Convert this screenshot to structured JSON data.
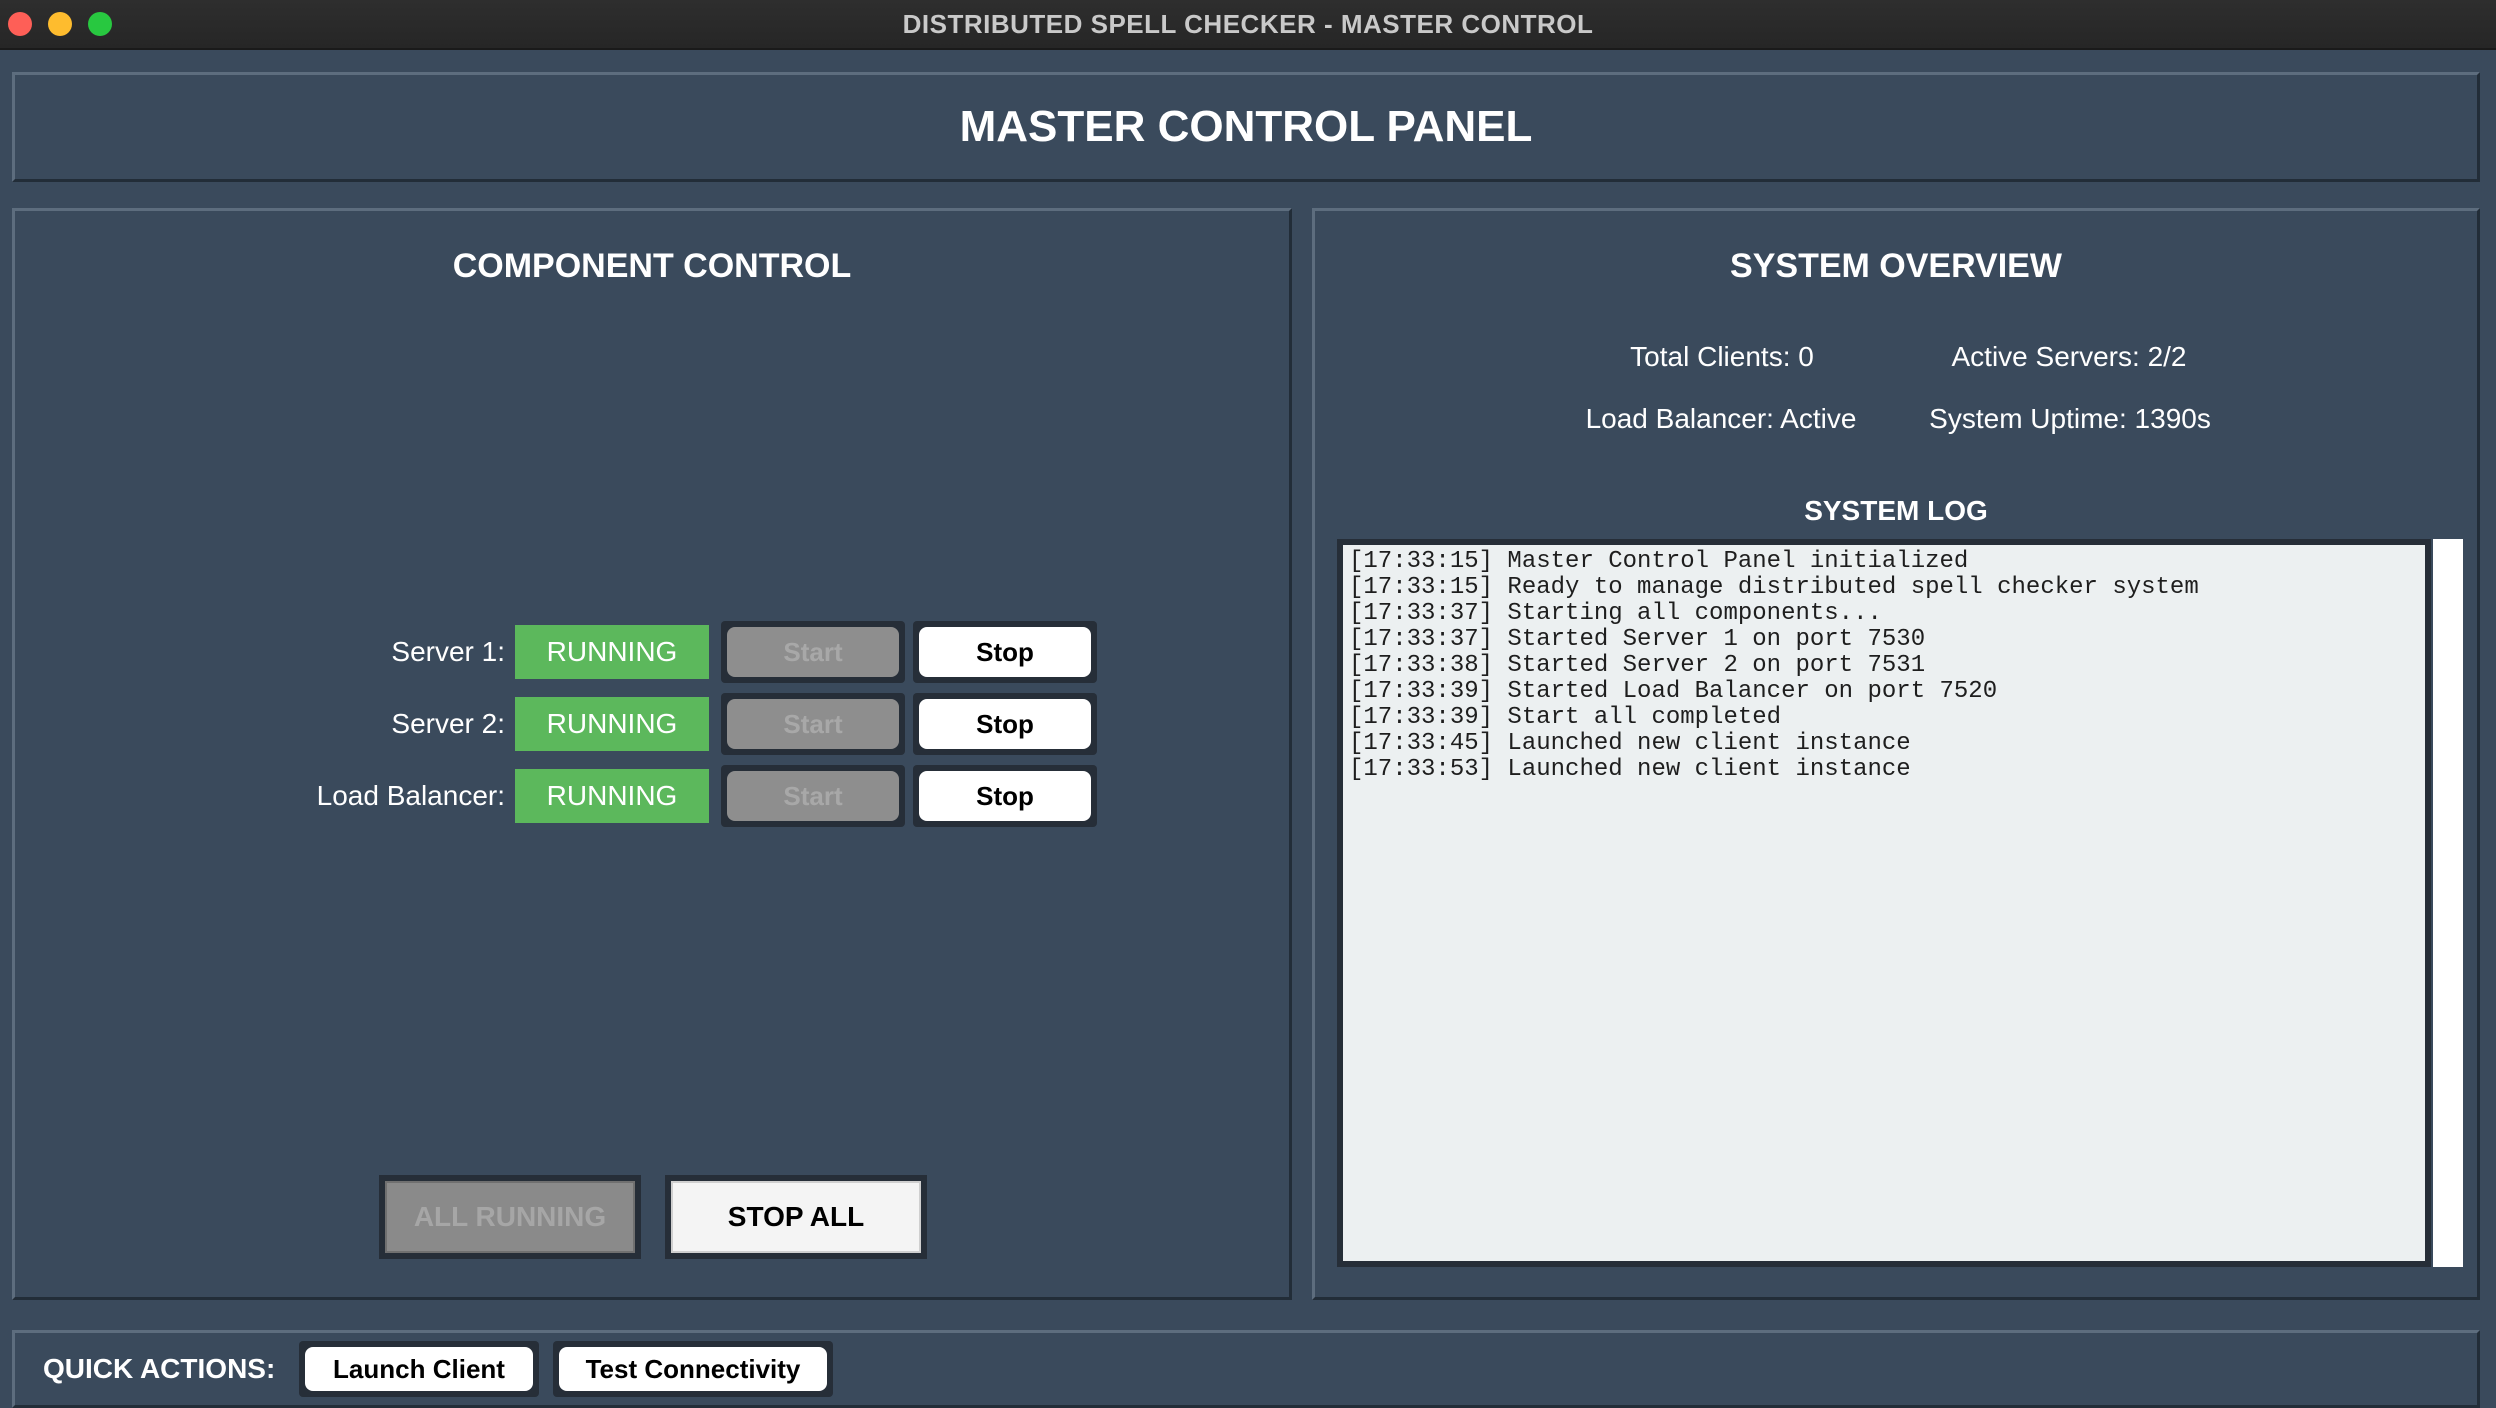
{
  "window": {
    "title": "DISTRIBUTED SPELL CHECKER - MASTER CONTROL"
  },
  "header": {
    "title": "MASTER CONTROL PANEL"
  },
  "component_control": {
    "heading": "COMPONENT CONTROL",
    "components": [
      {
        "label": "Server 1:",
        "status": "RUNNING",
        "start_label": "Start",
        "stop_label": "Stop"
      },
      {
        "label": "Server 2:",
        "status": "RUNNING",
        "start_label": "Start",
        "stop_label": "Stop"
      },
      {
        "label": "Load Balancer:",
        "status": "RUNNING",
        "start_label": "Start",
        "stop_label": "Stop"
      }
    ],
    "all_running_label": "ALL RUNNING",
    "stop_all_label": "STOP ALL"
  },
  "system_overview": {
    "heading": "SYSTEM OVERVIEW",
    "total_clients": "Total Clients: 0",
    "active_servers": "Active Servers: 2/2",
    "load_balancer": "Load Balancer: Active",
    "uptime": "System Uptime: 1390s",
    "log_heading": "SYSTEM LOG",
    "log_lines": [
      "[17:33:15] Master Control Panel initialized",
      "[17:33:15] Ready to manage distributed spell checker system",
      "[17:33:37] Starting all components...",
      "[17:33:37] Started Server 1 on port 7530",
      "[17:33:38] Started Server 2 on port 7531",
      "[17:33:39] Started Load Balancer on port 7520",
      "[17:33:39] Start all completed",
      "[17:33:45] Launched new client instance",
      "[17:33:53] Launched new client instance"
    ]
  },
  "quick_actions": {
    "label": "QUICK ACTIONS:",
    "launch_client": "Launch Client",
    "test_connectivity": "Test Connectivity"
  },
  "colors": {
    "background": "#3a4a5c",
    "running": "#5cb85c",
    "log_background": "#ecf0f1"
  }
}
